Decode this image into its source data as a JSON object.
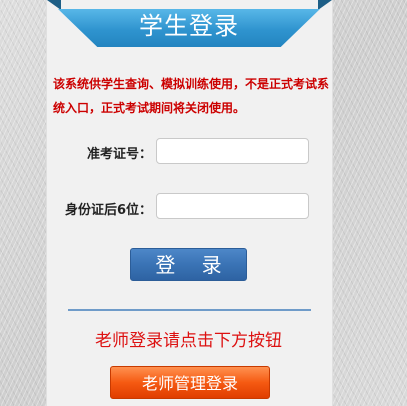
{
  "header": {
    "title": "学生登录"
  },
  "notice": {
    "text": "该系统供学生查询、模拟训练使用，不是正式考试系统入口，正式考试期间将关闭使用。"
  },
  "form": {
    "exam_number_label": "准考证号：",
    "exam_number_value": "",
    "id_last6_label": "身份证后6位：",
    "id_last6_value": ""
  },
  "login_button": {
    "label": "登 录"
  },
  "teacher": {
    "hint": "老师登录请点击下方按钮",
    "button_label": "老师管理登录"
  },
  "colors": {
    "ribbon": "#2f94cf",
    "notice_text": "#cc0000",
    "login_button": "#3a73b5",
    "teacher_hint": "#dd1111",
    "teacher_button": "#f55a12"
  }
}
